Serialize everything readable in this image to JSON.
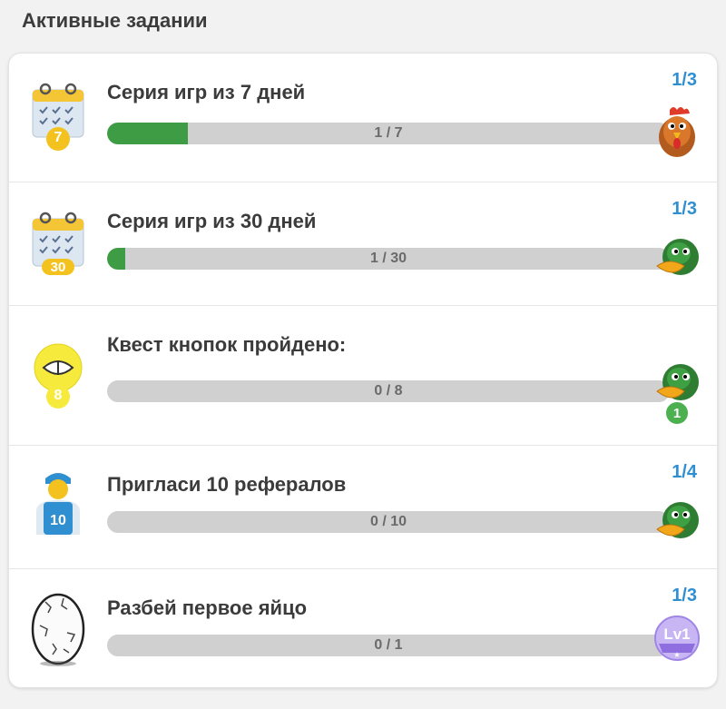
{
  "section_title": "Активные задании",
  "quests": [
    {
      "title": "Серия игр из 7 дней",
      "counter": "1/3",
      "progress_text": "1 / 7",
      "progress": 0.143,
      "icon": "calendar-icon",
      "icon_badge": "7",
      "reward": "rooster-icon"
    },
    {
      "title": "Серия игр из 30 дней",
      "counter": "1/3",
      "progress_text": "1 / 30",
      "progress": 0.033,
      "icon": "calendar-icon",
      "icon_badge": "30",
      "reward": "duck-icon"
    },
    {
      "title": "Квест кнопок пройдено:",
      "counter": "",
      "progress_text": "0 / 8",
      "progress": 0,
      "icon": "eye-bulb-icon",
      "icon_badge": "8",
      "reward": "duck-icon",
      "reward_badge": "1"
    },
    {
      "title": "Пригласи 10 рефералов",
      "counter": "1/4",
      "progress_text": "0 / 10",
      "progress": 0,
      "icon": "user-icon",
      "icon_badge": "10",
      "reward": "duck-icon"
    },
    {
      "title": "Разбей первое яйцо",
      "counter": "1/3",
      "progress_text": "0 / 1",
      "progress": 0,
      "icon": "egg-icon",
      "reward": "level-badge-icon",
      "reward_label": "Lv1"
    }
  ],
  "colors": {
    "accent": "#2f8fd0",
    "progress": "#3d9c44",
    "track": "#d0d0d0"
  }
}
